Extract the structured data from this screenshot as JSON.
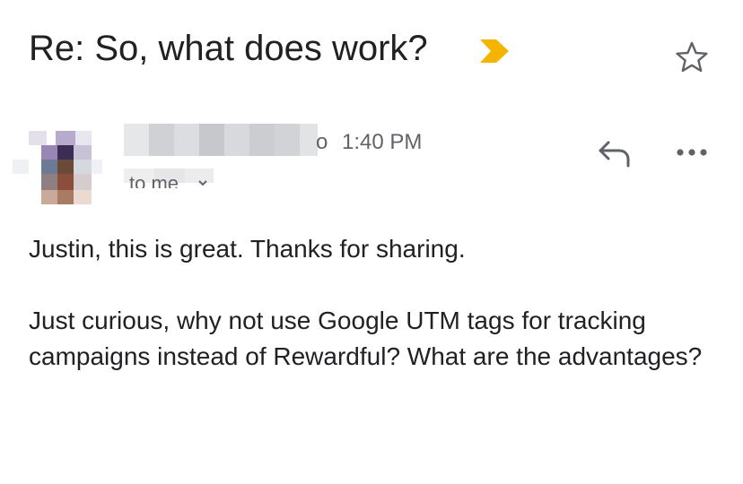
{
  "email": {
    "subject": "Re: So, what does work?",
    "importance_color": "#F4B400",
    "sender": {
      "name_visible_fragment": "o",
      "time": "1:40 PM",
      "recipient_label": "to me"
    },
    "body": {
      "paragraph_1": "Justin, this is great. Thanks for sharing.",
      "paragraph_2": "Just curious, why not use Google UTM tags for tracking campaigns instead of Rewardful? What are the advantages?"
    }
  },
  "icons": {
    "importance": "importance-marker-icon",
    "star": "star-icon",
    "reply": "reply-icon",
    "more": "more-options-icon",
    "recipient_details": "chevron-down-icon"
  }
}
